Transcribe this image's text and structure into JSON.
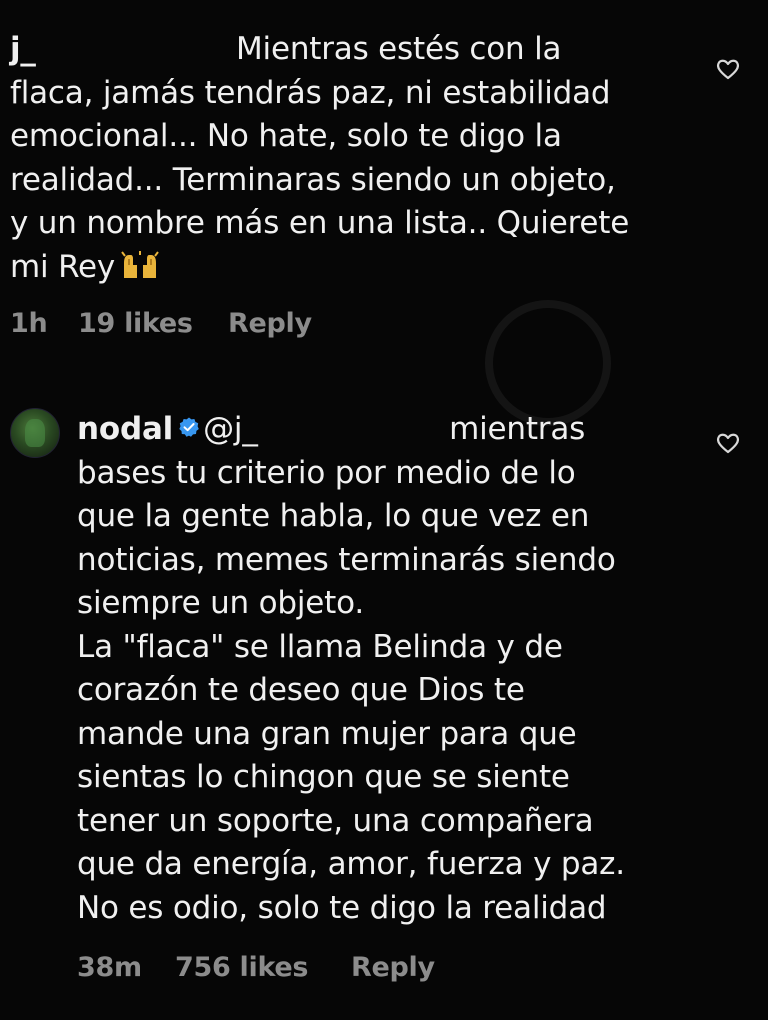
{
  "comment_1": {
    "username": "j_",
    "text": "Mientras estés con la\nflaca, jamás tendrás paz, ni estabilidad\nemocional... No hate, solo te digo la\nrealidad... Terminaras siendo un objeto,\ny un nombre más en una lista.. Quierete\nmi Rey",
    "emoji": "raising-hands-emoji",
    "time": "1h",
    "likes": "19 likes",
    "reply_label": "Reply",
    "like_icon": "heart-icon"
  },
  "comment_2": {
    "username": "nodal",
    "verified_icon": "verified-badge-icon",
    "mention": "@j_",
    "text": "mientras\nbases tu criterio por medio de lo\nque la gente habla, lo que vez en\nnoticias, memes terminarás siendo\nsiempre un objeto.\nLa \"flaca\" se llama Belinda y de\ncorazón te deseo que Dios te\nmande una gran mujer para que\nsientas lo chingon que se siente\ntener un soporte, una compañera\nque da energía, amor, fuerza y paz.\nNo es odio, solo te digo la realidad",
    "time": "38m",
    "likes": "756 likes",
    "reply_label": "Reply",
    "like_icon": "heart-icon"
  },
  "colors": {
    "background": "#060606",
    "text": "#f0f0f0",
    "meta": "#8c8c8c",
    "verified": "#3897f0"
  }
}
